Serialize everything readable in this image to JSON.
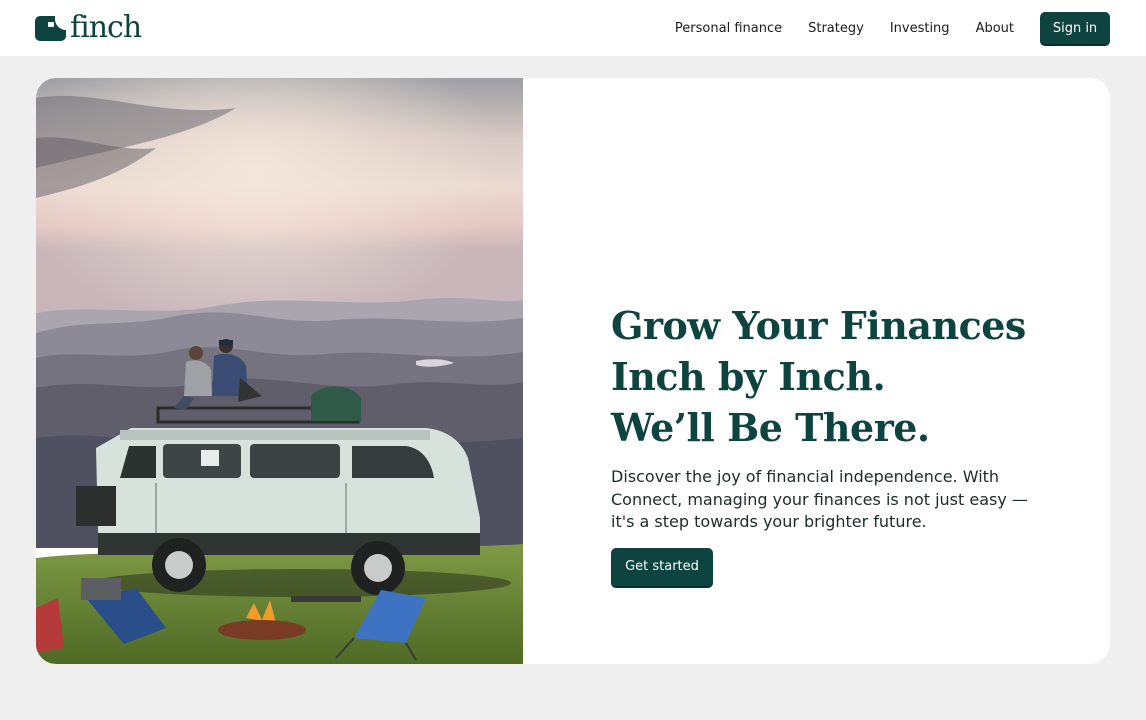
{
  "brand": {
    "name": "finch",
    "color": "#0e4440"
  },
  "nav": {
    "items": [
      {
        "label": "Personal finance"
      },
      {
        "label": "Strategy"
      },
      {
        "label": "Investing"
      },
      {
        "label": "About"
      }
    ],
    "signin_label": "Sign in"
  },
  "hero": {
    "image_icon": "campervan-mountain-photo",
    "headline": {
      "line1": "Grow Your Finances",
      "line2": "Inch by Inch.",
      "line3": "We’ll Be There."
    },
    "description": "Discover the joy of financial independence. With Connect, managing your finances is not just easy — it's a step towards your brighter future.",
    "cta_label": "Get started"
  },
  "colors": {
    "primary": "#0e4440",
    "background": "#efefef",
    "card": "#ffffff"
  }
}
